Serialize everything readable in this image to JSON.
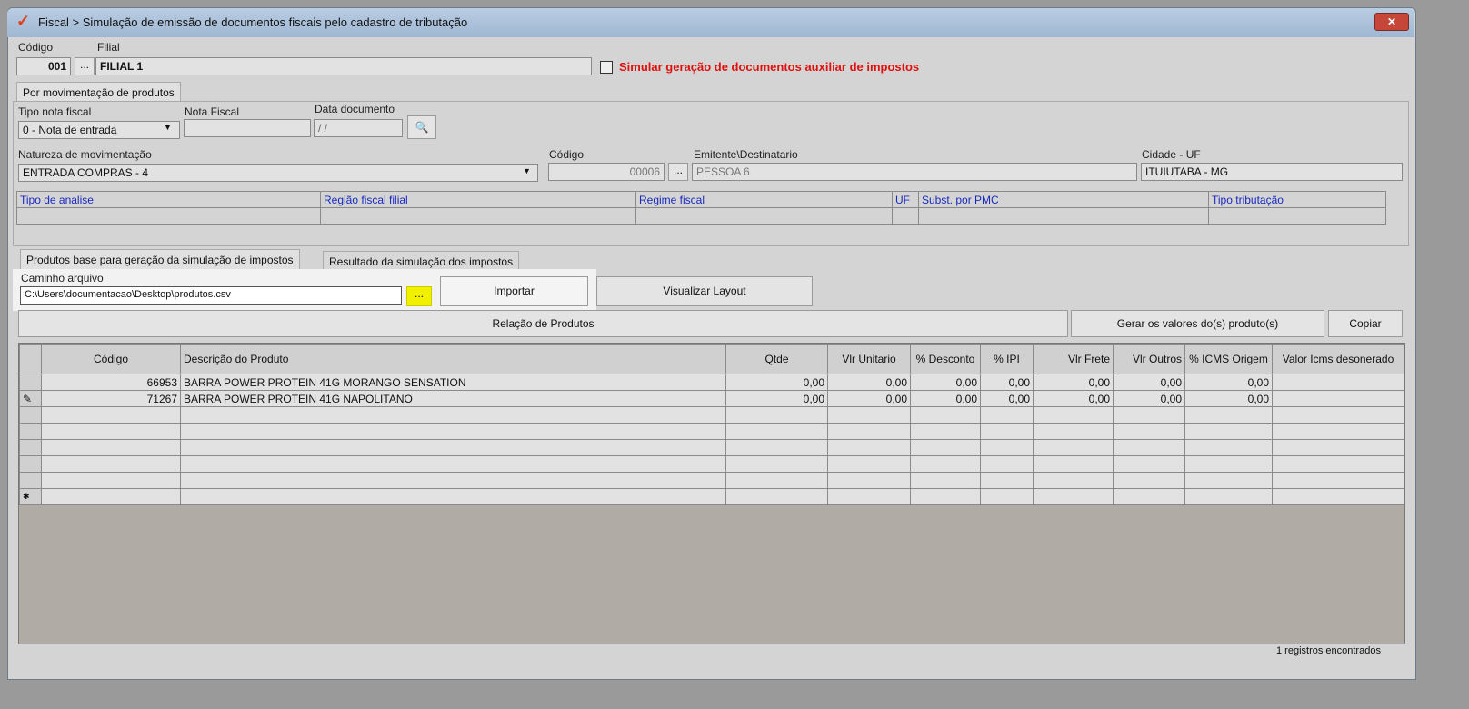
{
  "window": {
    "title": "Fiscal > Simulação de emissão de documentos fiscais pelo cadastro de tributação",
    "close": "✕"
  },
  "header": {
    "codigo_label": "Código",
    "codigo": "001",
    "filial_label": "Filial",
    "filial": "FILIAL 1",
    "ellipsis": "...",
    "simular_label": "Simular geração de documentos auxiliar de impostos"
  },
  "top_tab": "Por movimentação de produtos",
  "form": {
    "tipo_label": "Tipo nota fiscal",
    "tipo": "0 - Nota de entrada",
    "nf_label": "Nota Fiscal",
    "nf": "",
    "data_label": "Data documento",
    "data": " /  /",
    "natureza_label": "Natureza de movimentação",
    "natureza": "ENTRADA COMPRAS - 4",
    "codigo_label": "Código",
    "codigo": "00006",
    "emitente_label": "Emitente\\Destinatario",
    "emitente": "PESSOA 6",
    "cidade_label": "Cidade - UF",
    "cidade": "ITUIUTABA - MG"
  },
  "analysis_headers": [
    "Tipo de analise",
    "Região fiscal filial",
    "Regime fiscal",
    "UF",
    "Subst. por PMC",
    "Tipo tributação"
  ],
  "tabs": [
    "Produtos base para geração da simulação de impostos",
    "Resultado da simulação dos impostos"
  ],
  "import": {
    "label": "Caminho arquivo",
    "path": "C:\\Users\\documentacao\\Desktop\\produtos.csv",
    "browse": "...",
    "importar": "Importar",
    "visualizar": "Visualizar Layout"
  },
  "relacao": "Relação de Produtos",
  "gerar": "Gerar os valores do(s) produto(s)",
  "copiar": "Copiar",
  "grid": {
    "columns": [
      "Código",
      "Descrição do Produto",
      "Qtde",
      "Vlr Unitario",
      "% Desconto",
      "% IPI",
      "Vlr Frete",
      "Vlr Outros",
      "% ICMS Origem",
      "Valor Icms desonerado"
    ],
    "rows": [
      [
        "66953",
        "BARRA POWER PROTEIN 41G MORANGO SENSATION",
        "0,00",
        "0,00",
        "0,00",
        "0,00",
        "0,00",
        "0,00",
        "0,00",
        ""
      ],
      [
        "71267",
        "BARRA POWER PROTEIN 41G NAPOLITANO",
        "0,00",
        "0,00",
        "0,00",
        "0,00",
        "0,00",
        "0,00",
        "0,00",
        ""
      ]
    ]
  },
  "status": "1 registros encontrados"
}
